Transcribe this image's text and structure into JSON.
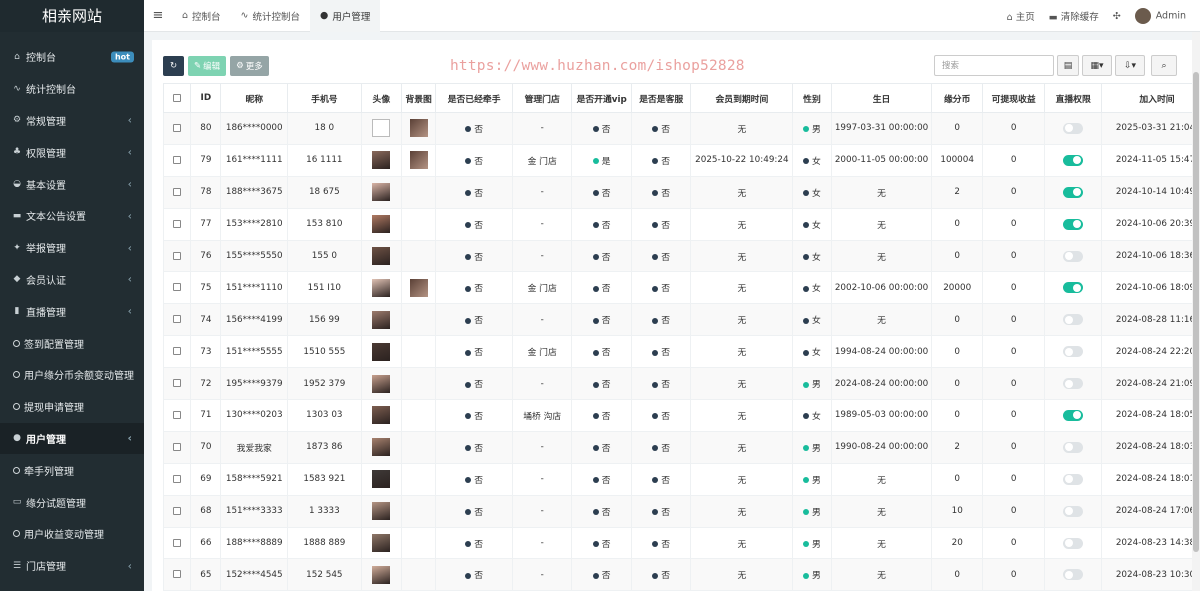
{
  "app": {
    "logo": "相亲网站"
  },
  "sidebar": {
    "items": [
      {
        "label": "控制台",
        "icon": "dashboard-icon",
        "glyph": "⌂",
        "badge": "hot"
      },
      {
        "label": "统计控制台",
        "icon": "chart-icon",
        "glyph": "∿"
      },
      {
        "label": "常规管理",
        "icon": "cogs-icon",
        "glyph": "⚙",
        "arrow": "‹"
      },
      {
        "label": "权限管理",
        "icon": "users-icon",
        "glyph": "♣",
        "arrow": "‹"
      },
      {
        "label": "基本设置",
        "icon": "tachometer-icon",
        "glyph": "◒",
        "arrow": "‹"
      },
      {
        "label": "文本公告设置",
        "icon": "car-icon",
        "glyph": "▬",
        "arrow": "‹"
      },
      {
        "label": "举报管理",
        "icon": "gavel-icon",
        "glyph": "✦",
        "arrow": "‹"
      },
      {
        "label": "会员认证",
        "icon": "diamond-icon",
        "glyph": "◆",
        "arrow": "‹"
      },
      {
        "label": "直播管理",
        "icon": "book-icon",
        "glyph": "▮",
        "arrow": "‹"
      },
      {
        "label": "签到配置管理",
        "icon": "circle-icon",
        "sub": true
      },
      {
        "label": "用户缘分币余额变动管理",
        "icon": "circle-icon",
        "sub": true
      },
      {
        "label": "提现申请管理",
        "icon": "circle-icon",
        "sub": true
      },
      {
        "label": "用户管理",
        "icon": "user-circle-icon",
        "glyph": "●",
        "arrow": "‹",
        "active": true
      },
      {
        "label": "牵手列管理",
        "icon": "circle-icon",
        "sub": true
      },
      {
        "label": "缘分试题管理",
        "icon": "keyboard-icon",
        "glyph": "▭"
      },
      {
        "label": "用户收益变动管理",
        "icon": "circle-icon",
        "sub": true
      },
      {
        "label": "门店管理",
        "icon": "list-icon",
        "glyph": "☰",
        "arrow": "‹"
      }
    ]
  },
  "topbar": {
    "menu_icon": "≡",
    "tabs": [
      {
        "label": "控制台",
        "icon": "dashboard-icon",
        "glyph": "⌂"
      },
      {
        "label": "统计控制台",
        "icon": "chart-icon",
        "glyph": "∿"
      },
      {
        "label": "用户管理",
        "icon": "user-icon",
        "glyph": "●",
        "active": true
      }
    ],
    "home": "主页",
    "clear_cache": "清除缓存",
    "fullscreen_glyph": "✣",
    "admin": "Admin"
  },
  "toolbar": {
    "refresh_glyph": "↻",
    "edit": "编辑",
    "more": "更多",
    "search_placeholder": "搜索"
  },
  "watermark": "https://www.huzhan.com/ishop52828",
  "table": {
    "columns": [
      "ID",
      "昵称",
      "手机号",
      "头像",
      "背景图",
      "是否已经牵手",
      "管理门店",
      "是否开通vip",
      "是否是客服",
      "会员到期时间",
      "性别",
      "生日",
      "缘分币",
      "可提现收益",
      "直播权限",
      "加入时间"
    ],
    "rows": [
      {
        "id": "80",
        "nick": "186****0000",
        "phone": "18 0",
        "avatar": "blank",
        "bg": true,
        "hand": "否",
        "store": "-",
        "vip": "否",
        "vip_on": false,
        "service": "否",
        "expire": "无",
        "gender": "男",
        "male": true,
        "birthday": "1997-03-31 00:00:00",
        "coins": "0",
        "income": "0",
        "live": false,
        "joined": "2025-03-31 21:04:"
      },
      {
        "id": "79",
        "nick": "161****1111",
        "phone": "16 1111",
        "avatar": "photo",
        "bg": true,
        "hand": "否",
        "store": "金 门店",
        "vip": "是",
        "vip_on": true,
        "service": "否",
        "expire": "2025-10-22 10:49:24",
        "gender": "女",
        "male": false,
        "birthday": "2000-11-05 00:00:00",
        "coins": "100004",
        "income": "0",
        "live": true,
        "joined": "2024-11-05 15:47:"
      },
      {
        "id": "78",
        "nick": "188****3675",
        "phone": "18 675",
        "avatar": "photo",
        "bg": false,
        "hand": "否",
        "store": "-",
        "vip": "否",
        "vip_on": false,
        "service": "否",
        "expire": "无",
        "gender": "女",
        "male": false,
        "birthday": "无",
        "coins": "2",
        "income": "0",
        "live": true,
        "joined": "2024-10-14 10:49:"
      },
      {
        "id": "77",
        "nick": "153****2810",
        "phone": "153 810",
        "avatar": "photo",
        "bg": false,
        "hand": "否",
        "store": "-",
        "vip": "否",
        "vip_on": false,
        "service": "否",
        "expire": "无",
        "gender": "女",
        "male": false,
        "birthday": "无",
        "coins": "0",
        "income": "0",
        "live": true,
        "joined": "2024-10-06 20:39:"
      },
      {
        "id": "76",
        "nick": "155****5550",
        "phone": "155 0",
        "avatar": "photo",
        "bg": false,
        "hand": "否",
        "store": "-",
        "vip": "否",
        "vip_on": false,
        "service": "否",
        "expire": "无",
        "gender": "女",
        "male": false,
        "birthday": "无",
        "coins": "0",
        "income": "0",
        "live": false,
        "joined": "2024-10-06 18:36:"
      },
      {
        "id": "75",
        "nick": "151****1110",
        "phone": "151 I10",
        "avatar": "photo",
        "bg": true,
        "hand": "否",
        "store": "金 门店",
        "vip": "否",
        "vip_on": false,
        "service": "否",
        "expire": "无",
        "gender": "女",
        "male": false,
        "birthday": "2002-10-06 00:00:00",
        "coins": "20000",
        "income": "0",
        "live": true,
        "joined": "2024-10-06 18:09:"
      },
      {
        "id": "74",
        "nick": "156****4199",
        "phone": "156 99",
        "avatar": "photo",
        "bg": false,
        "hand": "否",
        "store": "-",
        "vip": "否",
        "vip_on": false,
        "service": "否",
        "expire": "无",
        "gender": "女",
        "male": false,
        "birthday": "无",
        "coins": "0",
        "income": "0",
        "live": false,
        "joined": "2024-08-28 11:16:"
      },
      {
        "id": "73",
        "nick": "151****5555",
        "phone": "1510 555",
        "avatar": "photo",
        "bg": false,
        "hand": "否",
        "store": "金 门店",
        "vip": "否",
        "vip_on": false,
        "service": "否",
        "expire": "无",
        "gender": "女",
        "male": false,
        "birthday": "1994-08-24 00:00:00",
        "coins": "0",
        "income": "0",
        "live": false,
        "joined": "2024-08-24 22:20:"
      },
      {
        "id": "72",
        "nick": "195****9379",
        "phone": "1952 379",
        "avatar": "photo",
        "bg": false,
        "hand": "否",
        "store": "-",
        "vip": "否",
        "vip_on": false,
        "service": "否",
        "expire": "无",
        "gender": "男",
        "male": true,
        "birthday": "2024-08-24 00:00:00",
        "coins": "0",
        "income": "0",
        "live": false,
        "joined": "2024-08-24 21:09:"
      },
      {
        "id": "71",
        "nick": "130****0203",
        "phone": "1303 03",
        "avatar": "photo",
        "bg": false,
        "hand": "否",
        "store": "埇桥 沟店",
        "vip": "否",
        "vip_on": false,
        "service": "否",
        "expire": "无",
        "gender": "女",
        "male": false,
        "birthday": "1989-05-03 00:00:00",
        "coins": "0",
        "income": "0",
        "live": true,
        "joined": "2024-08-24 18:05:"
      },
      {
        "id": "70",
        "nick": "我爱我家",
        "phone": "1873 86",
        "avatar": "photo",
        "bg": false,
        "hand": "否",
        "store": "-",
        "vip": "否",
        "vip_on": false,
        "service": "否",
        "expire": "无",
        "gender": "男",
        "male": true,
        "birthday": "1990-08-24 00:00:00",
        "coins": "2",
        "income": "0",
        "live": false,
        "joined": "2024-08-24 18:03:"
      },
      {
        "id": "69",
        "nick": "158****5921",
        "phone": "1583 921",
        "avatar": "photo",
        "bg": false,
        "hand": "否",
        "store": "-",
        "vip": "否",
        "vip_on": false,
        "service": "否",
        "expire": "无",
        "gender": "男",
        "male": true,
        "birthday": "无",
        "coins": "0",
        "income": "0",
        "live": false,
        "joined": "2024-08-24 18:01:"
      },
      {
        "id": "68",
        "nick": "151****3333",
        "phone": "1 3333",
        "avatar": "photo",
        "bg": false,
        "hand": "否",
        "store": "-",
        "vip": "否",
        "vip_on": false,
        "service": "否",
        "expire": "无",
        "gender": "男",
        "male": true,
        "birthday": "无",
        "coins": "10",
        "income": "0",
        "live": false,
        "joined": "2024-08-24 17:06:"
      },
      {
        "id": "66",
        "nick": "188****8889",
        "phone": "1888 889",
        "avatar": "photo",
        "bg": false,
        "hand": "否",
        "store": "-",
        "vip": "否",
        "vip_on": false,
        "service": "否",
        "expire": "无",
        "gender": "男",
        "male": true,
        "birthday": "无",
        "coins": "20",
        "income": "0",
        "live": false,
        "joined": "2024-08-23 14:38:"
      },
      {
        "id": "65",
        "nick": "152****4545",
        "phone": "152 545",
        "avatar": "photo",
        "bg": false,
        "hand": "否",
        "store": "-",
        "vip": "否",
        "vip_on": false,
        "service": "否",
        "expire": "无",
        "gender": "男",
        "male": true,
        "birthday": "无",
        "coins": "0",
        "income": "0",
        "live": false,
        "joined": "2024-08-23 10:30:"
      }
    ]
  },
  "colors": {
    "sidebar_bg": "#222d32",
    "accent": "#18bc9c",
    "dark": "#2c3e50",
    "edit_btn": "#7ed3b2",
    "more_btn": "#95a5a6"
  }
}
